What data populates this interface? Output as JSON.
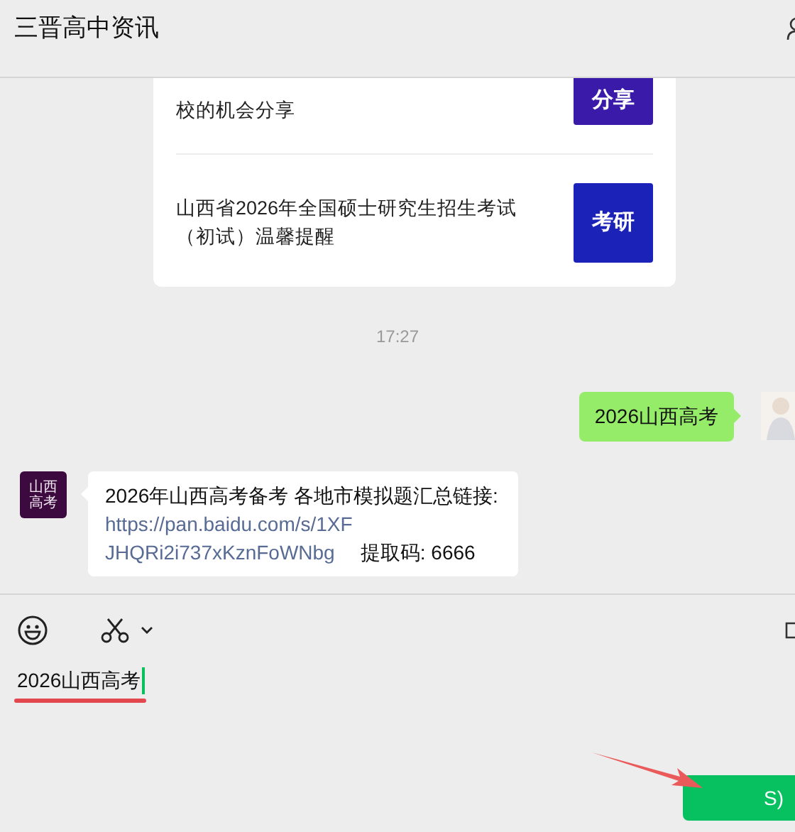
{
  "header": {
    "title": "三晋高中资讯"
  },
  "articles": [
    {
      "title": "校的机会分享",
      "thumb_text": "分享",
      "color": "#3a1aa8"
    },
    {
      "title": "山西省2026年全国硕士研究生招生考试（初试）温馨提醒",
      "thumb_text": "考研",
      "color": "#1a22b8"
    }
  ],
  "time": "17:27",
  "messages": [
    {
      "kind": "sent",
      "text": "2026山西高考"
    },
    {
      "kind": "received",
      "avatar_text": "山西高考",
      "text": "2026年山西高考备考 各地市模拟题汇总链接:",
      "link": "https://pan.baidu.com/s/1XFJHQRi2i737xKznFoWNbg",
      "suffix": " 提取码: 6666"
    }
  ],
  "input": {
    "value": "2026山西高考"
  },
  "send_button": {
    "label": "S)"
  }
}
